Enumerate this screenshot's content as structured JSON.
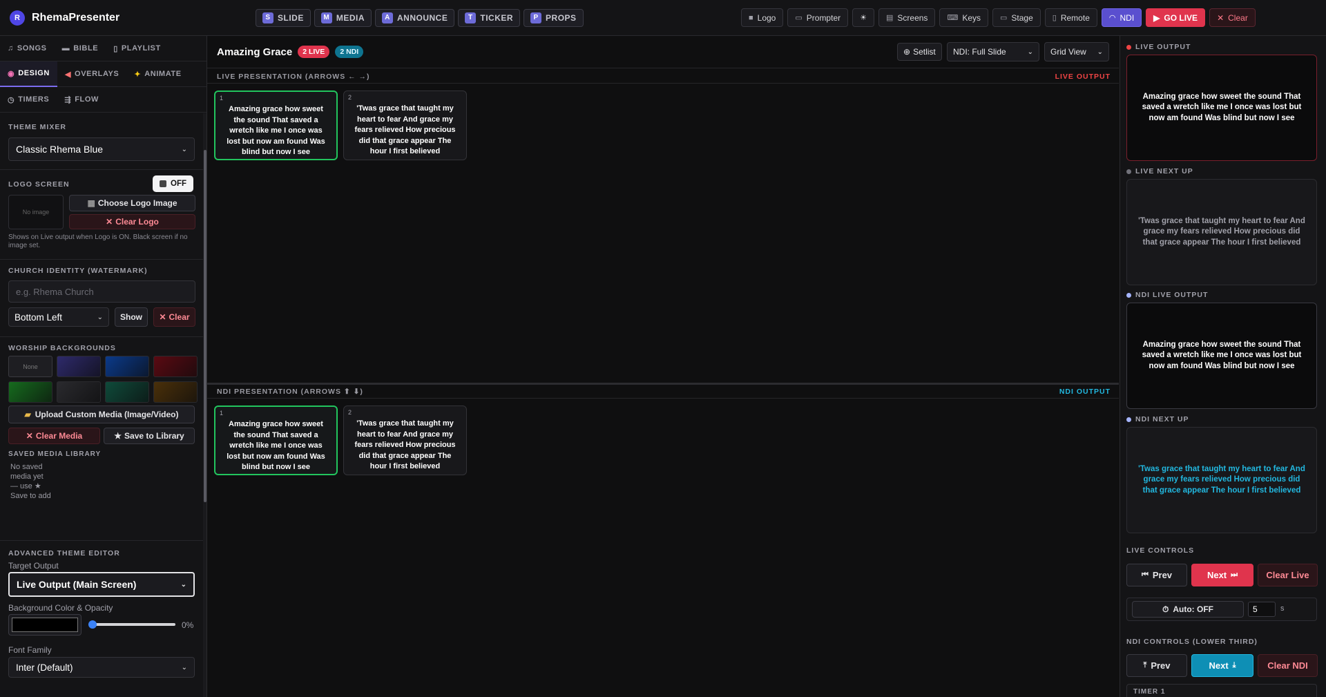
{
  "app": {
    "name": "RhemaPresenter",
    "logo_initial": "R"
  },
  "modes": [
    {
      "key": "S",
      "label": "SLIDE"
    },
    {
      "key": "M",
      "label": "MEDIA"
    },
    {
      "key": "A",
      "label": "ANNOUNCE"
    },
    {
      "key": "T",
      "label": "TICKER"
    },
    {
      "key": "P",
      "label": "PROPS"
    }
  ],
  "toolbar": {
    "logo": "Logo",
    "prompter": "Prompter",
    "screens": "Screens",
    "keys": "Keys",
    "stage": "Stage",
    "remote": "Remote",
    "ndi": "NDI",
    "golive": "GO LIVE",
    "clear": "Clear"
  },
  "left": {
    "tabs_row1": [
      "SONGS",
      "BIBLE",
      "PLAYLIST"
    ],
    "tabs_row2": [
      "DESIGN",
      "OVERLAYS",
      "ANIMATE"
    ],
    "tabs_row3": [
      "TIMERS",
      "FLOW"
    ],
    "theme_mixer": {
      "title": "THEME MIXER",
      "value": "Classic Rhema Blue"
    },
    "logo_screen": {
      "title": "LOGO SCREEN",
      "toggle": "OFF",
      "no_image": "No image",
      "choose": "Choose Logo Image",
      "clear": "Clear Logo",
      "hint": "Shows on Live output when Logo is ON. Black screen if no image set."
    },
    "church_identity": {
      "title": "CHURCH IDENTITY (WATERMARK)",
      "placeholder": "e.g. Rhema Church",
      "position": "Bottom Left",
      "show": "Show",
      "clear": "Clear"
    },
    "worship_backgrounds": {
      "title": "WORSHIP BACKGROUNDS",
      "none": "None",
      "swatch_colors": [
        "#2e2a6b",
        "#0b3a8a",
        "#5a0a12",
        "#166b1e",
        "#2a2a2e",
        "#0f4a3a",
        "#4a300a"
      ],
      "upload": "Upload Custom Media (Image/Video)",
      "clear_media": "Clear Media",
      "save_library": "Save to Library"
    },
    "saved_media": {
      "title": "SAVED MEDIA LIBRARY",
      "empty": "No saved media yet — use ★ Save to add"
    },
    "advanced": {
      "title": "ADVANCED THEME EDITOR",
      "target_label": "Target Output",
      "target_value": "Live Output (Main Screen)",
      "bg_label": "Background Color & Opacity",
      "opacity": "0%",
      "font_label": "Font Family",
      "font_value": "Inter (Default)"
    }
  },
  "main": {
    "title": "Amazing Grace",
    "badge_live": "2 LIVE",
    "badge_ndi": "2 NDI",
    "setlist": "Setlist",
    "ndi_mode": "NDI: Full Slide",
    "view": "Grid View",
    "live_panel": {
      "label": "LIVE PRESENTATION (ARROWS ← →)",
      "tag": "LIVE OUTPUT"
    },
    "ndi_panel": {
      "label": "NDI PRESENTATION (ARROWS ⬆ ⬇)",
      "tag": "NDI OUTPUT"
    },
    "slides": [
      {
        "num": "1",
        "text": "Amazing grace how sweet the sound That saved a wretch like me I once was lost but now am found Was blind but now I see"
      },
      {
        "num": "2",
        "text": "'Twas grace that taught my heart to fear And grace my fears relieved How precious did that grace appear The hour I first believed"
      }
    ]
  },
  "right": {
    "live_output": {
      "label": "LIVE OUTPUT",
      "text": "Amazing grace how sweet the sound That saved a wretch like me I once was lost but now am found Was blind but now I see"
    },
    "live_next": {
      "label": "LIVE NEXT UP",
      "text": "'Twas grace that taught my heart to fear And grace my fears relieved How precious did that grace appear The hour I first believed"
    },
    "ndi_output": {
      "label": "NDI LIVE OUTPUT",
      "text": "Amazing grace how sweet the sound That saved a wretch like me I once was lost but now am found Was blind but now I see"
    },
    "ndi_next": {
      "label": "NDI NEXT UP",
      "text": "'Twas grace that taught my heart to fear And grace my fears relieved How precious did that grace appear The hour I first believed"
    },
    "live_controls": {
      "title": "LIVE CONTROLS",
      "prev": "Prev",
      "next": "Next",
      "clear": "Clear Live",
      "auto": "Auto: OFF",
      "seconds": "5",
      "unit": "s"
    },
    "ndi_controls": {
      "title": "NDI CONTROLS (LOWER THIRD)",
      "prev": "Prev",
      "next": "Next",
      "clear": "Clear NDI"
    },
    "timer_label": "TIMER 1"
  },
  "colors": {
    "accent": "#7c6cf0",
    "live": "#e0344d",
    "ndi": "#0ea5c6",
    "selected": "#22c55e"
  }
}
